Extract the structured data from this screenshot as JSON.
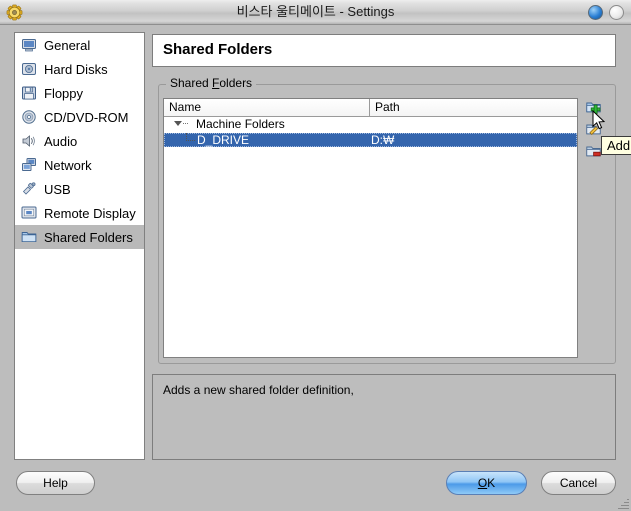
{
  "window": {
    "title": "비스타 울티메이트 - Settings",
    "app_icon": "gear-icon",
    "minimize_label": "",
    "close_label": ""
  },
  "sidebar": {
    "items": [
      {
        "label": "General",
        "icon": "monitor-icon",
        "selected": false
      },
      {
        "label": "Hard Disks",
        "icon": "harddisk-icon",
        "selected": false
      },
      {
        "label": "Floppy",
        "icon": "floppy-icon",
        "selected": false
      },
      {
        "label": "CD/DVD-ROM",
        "icon": "cd-icon",
        "selected": false
      },
      {
        "label": "Audio",
        "icon": "speaker-icon",
        "selected": false
      },
      {
        "label": "Network",
        "icon": "network-icon",
        "selected": false
      },
      {
        "label": "USB",
        "icon": "usb-icon",
        "selected": false
      },
      {
        "label": "Remote Display",
        "icon": "remote-display-icon",
        "selected": false
      },
      {
        "label": "Shared Folders",
        "icon": "folder-icon",
        "selected": true
      }
    ]
  },
  "main": {
    "page_title": "Shared Folders",
    "group": {
      "legend_prefix": "Shared ",
      "legend_accesskey": "F",
      "legend_suffix": "olders"
    },
    "table": {
      "columns": [
        "Name",
        "Path"
      ],
      "rows": [
        {
          "name": "Machine Folders",
          "path": "",
          "type": "group",
          "expanded": true,
          "selected": false
        },
        {
          "name": "D_DRIVE",
          "path": "D:₩",
          "type": "item",
          "expanded": false,
          "selected": true
        }
      ]
    },
    "toolbar": [
      {
        "name": "add-shared-folder",
        "icon": "folder-add-icon",
        "tooltip": "Add"
      },
      {
        "name": "edit-shared-folder",
        "icon": "folder-edit-icon",
        "tooltip": "Edit"
      },
      {
        "name": "remove-shared-folder",
        "icon": "folder-remove-icon",
        "tooltip": "Remove"
      }
    ],
    "description": "Adds a new shared folder definition,"
  },
  "tooltip": {
    "text": "Add"
  },
  "footer": {
    "help_label": "Help",
    "ok_prefix": "",
    "ok_accesskey": "O",
    "ok_suffix": "K",
    "cancel_label": "Cancel"
  },
  "colors": {
    "selection_blue": "#3465ad",
    "sidebar_selection": "#b9b9b9",
    "window_bg": "#bdbdbd",
    "tooltip_bg": "#ffffe1",
    "default_button_blue": "#4c9ae8"
  }
}
